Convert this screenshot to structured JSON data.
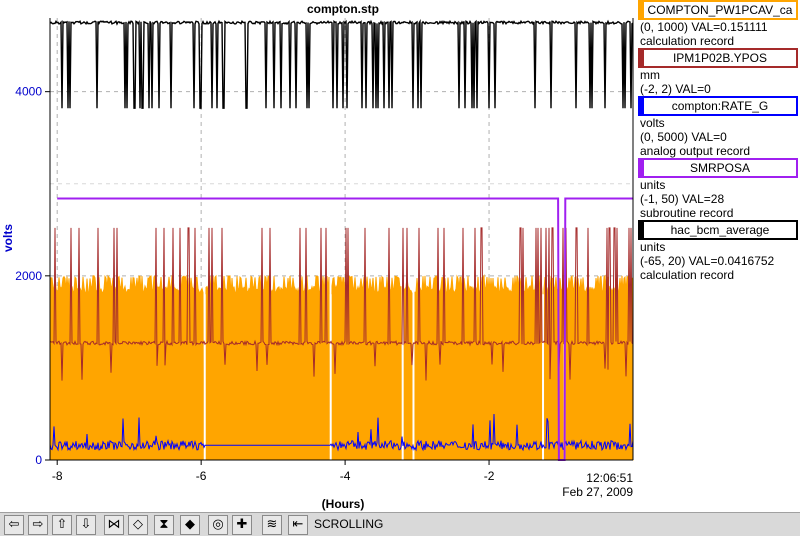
{
  "chart_data": {
    "type": "line",
    "title": "compton.stp",
    "ylabel": "volts",
    "xlabel": "(Hours)",
    "ylim": [
      0,
      4800
    ],
    "xlim": [
      -8.1,
      -0.0
    ],
    "yticks": [
      0,
      2000,
      4000
    ],
    "xticks": [
      -8,
      -6,
      -4,
      -2
    ],
    "x_end_label": [
      "12:06:51",
      "Feb 27, 2009"
    ],
    "grid": true,
    "legend_position": "right",
    "series": [
      {
        "name": "COMPTON_PW1PCAV_ca",
        "color": "#ffa500",
        "typical": 1850,
        "spike_high": 2000,
        "dropouts_x": [
          -5.95,
          -4.2,
          -3.2,
          -3.05,
          -1.25,
          -0.95
        ]
      },
      {
        "name": "IPM1P02B.YPOS",
        "color": "#a52a2a",
        "typical": 1270,
        "spike_high": 2520
      },
      {
        "name": "compton:RATE_G",
        "color": "#0000ff",
        "typical": 140,
        "segment_x": [
          -8,
          -5.95
        ]
      },
      {
        "name": "SMRPOSA",
        "color": "#a020f0",
        "x": [
          -8,
          -1.04,
          -1.03,
          -0.95,
          -0.94,
          0
        ],
        "y": [
          2840,
          2840,
          0,
          0,
          2840,
          2840
        ]
      },
      {
        "name": "hac_bcm_average",
        "color": "#000000",
        "typical": 4750,
        "dip_low": 3820
      }
    ]
  },
  "legend": [
    {
      "name": "COMPTON_PW1PCAV_ca",
      "unit": "",
      "range": "(0, 1000) VAL=0.151111",
      "type": "calculation record",
      "color": "#ffa500"
    },
    {
      "name": "IPM1P02B.YPOS",
      "unit": "mm",
      "range": "(-2, 2) VAL=0",
      "type": "",
      "color": "#a52a2a"
    },
    {
      "name": "compton:RATE_G",
      "unit": "volts",
      "range": "(0, 5000) VAL=0",
      "type": "analog output record",
      "color": "#0000ff"
    },
    {
      "name": "SMRPOSA",
      "unit": "units",
      "range": "(-1, 50) VAL=28",
      "type": "subroutine record",
      "color": "#a020f0"
    },
    {
      "name": "hac_bcm_average",
      "unit": "units",
      "range": "(-65, 20) VAL=0.0416752",
      "type": "calculation record",
      "color": "#000000"
    }
  ],
  "toolbar": {
    "status": "SCROLLING",
    "buttons": [
      {
        "name": "scroll-left-button",
        "glyph": "⇦"
      },
      {
        "name": "scroll-right-button",
        "glyph": "⇨"
      },
      {
        "name": "scroll-up-button",
        "glyph": "⇧"
      },
      {
        "name": "scroll-down-button",
        "glyph": "⇩"
      },
      {
        "name": "zoom-in-x-button",
        "glyph": "⋈"
      },
      {
        "name": "zoom-out-x-button",
        "glyph": "◇"
      },
      {
        "name": "zoom-in-y-button",
        "glyph": "⧗"
      },
      {
        "name": "zoom-out-y-button",
        "glyph": "◆"
      },
      {
        "name": "config-button",
        "glyph": "◎"
      },
      {
        "name": "add-button",
        "glyph": "✚"
      },
      {
        "name": "autoscale-button",
        "glyph": "≋"
      },
      {
        "name": "scroll-mode-button",
        "glyph": "⇤"
      }
    ]
  }
}
